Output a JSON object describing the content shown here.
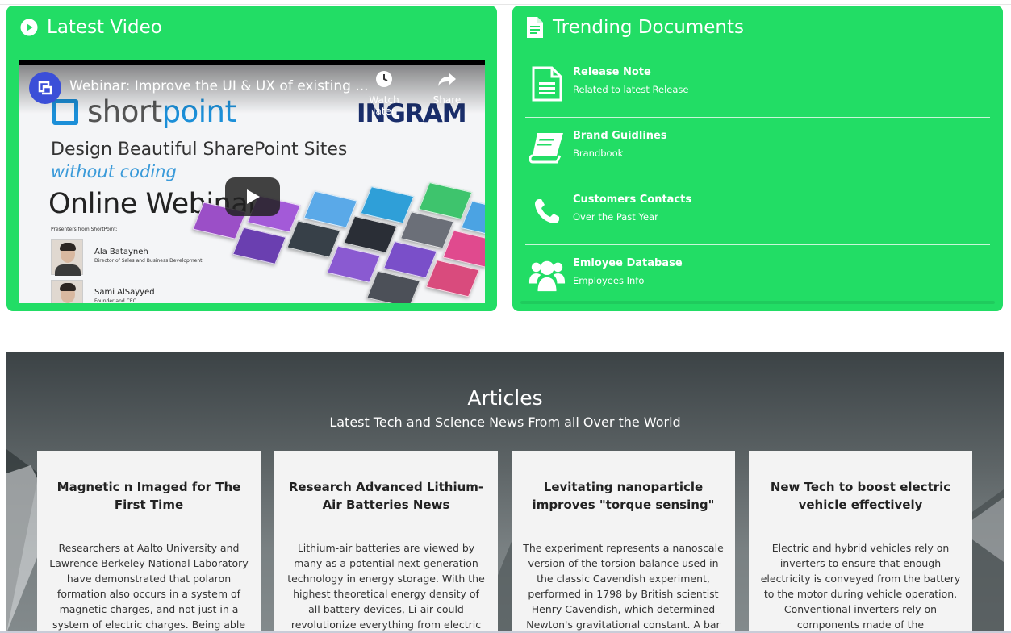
{
  "video_panel": {
    "title": "Latest Video",
    "video": {
      "title": "Webinar: Improve the UI & UX of existing ...",
      "watch_later": "Watch later",
      "share": "Share",
      "thumbnail": {
        "brand_a": "short",
        "brand_b": "point",
        "partner": "INGRAM",
        "line1": "Design Beautiful SharePoint Sites",
        "line2": "without coding",
        "line3": "Online Webinar",
        "presenters_label": "Presenters from ShortPoint:",
        "presenters": [
          {
            "name": "Ala Batayneh",
            "role": "Director of Sales and Business Development"
          },
          {
            "name": "Sami AlSayyed",
            "role": "Founder and CEO"
          }
        ]
      }
    }
  },
  "docs_panel": {
    "title": "Trending Documents",
    "items": [
      {
        "title": "Release Note",
        "subtitle": "Related to latest Release",
        "icon": "document-icon"
      },
      {
        "title": "Brand Guidlines",
        "subtitle": "Brandbook",
        "icon": "book-icon"
      },
      {
        "title": "Customers Contacts",
        "subtitle": "Over the Past Year",
        "icon": "phone-icon"
      },
      {
        "title": "Emloyee Database",
        "subtitle": "Employees Info",
        "icon": "users-icon"
      }
    ]
  },
  "articles": {
    "title": "Articles",
    "subtitle": "Latest Tech and Science News From all Over the World",
    "cards": [
      {
        "title": "Magnetic n Imaged for The First Time",
        "body": "Researchers at Aalto University and Lawrence Berkeley National Laboratory have demonstrated that polaron formation also occurs in a system of magnetic charges, and not just in a system of electric charges. Being able"
      },
      {
        "title": "Research Advanced Lithium-Air Batteries News",
        "body": "Lithium-air batteries are viewed by many as a potential next-generation technology in energy storage. With the highest theoretical energy density of all battery devices, Li-air could revolutionize everything from electric"
      },
      {
        "title": "Levitating nanoparticle improves \"torque sensing\"",
        "body": "The experiment represents a nanoscale version of the torsion balance used in the classic Cavendish experiment, performed in 1798 by British scientist Henry Cavendish, which determined Newton's gravitational constant. A bar"
      },
      {
        "title": "New Tech to boost electric vehicle effectively",
        "body": "Electric and hybrid vehicles rely on inverters to ensure that enough electricity is conveyed from the battery to the motor during vehicle operation. Conventional inverters rely on components made of the"
      }
    ]
  },
  "colors": {
    "panel_green": "#22dd65",
    "card_bg": "#f3f3f3",
    "text_white": "#ffffff"
  }
}
